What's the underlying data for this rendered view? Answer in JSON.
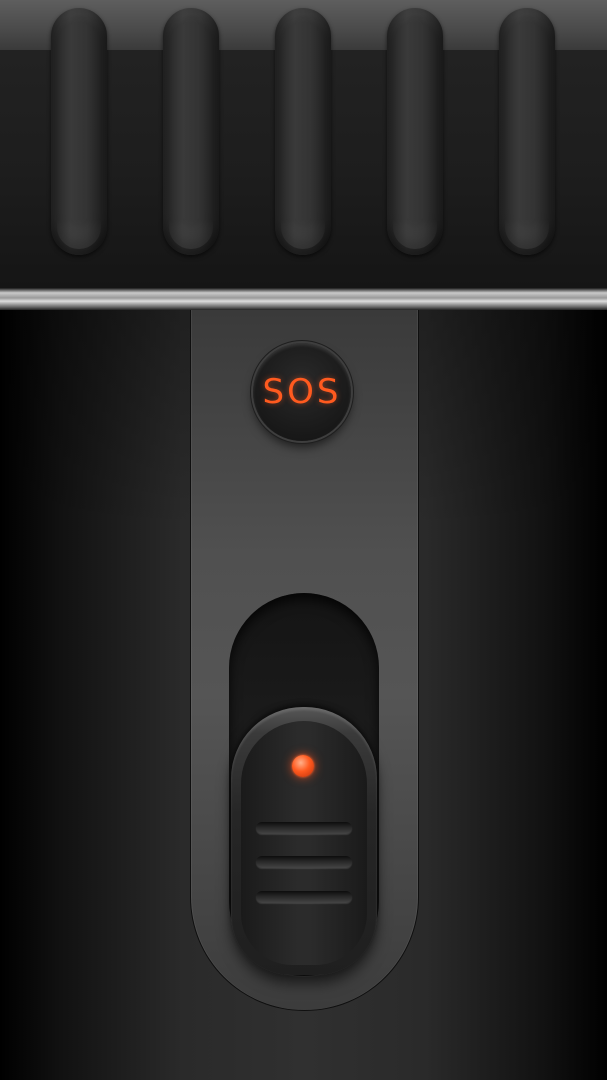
{
  "sos_button": {
    "label": "SOS",
    "color": "#ff5a1f"
  },
  "power_switch": {
    "state": "off",
    "indicator_color": "#ff5a1f"
  },
  "grip_grooves": {
    "count": 5
  }
}
